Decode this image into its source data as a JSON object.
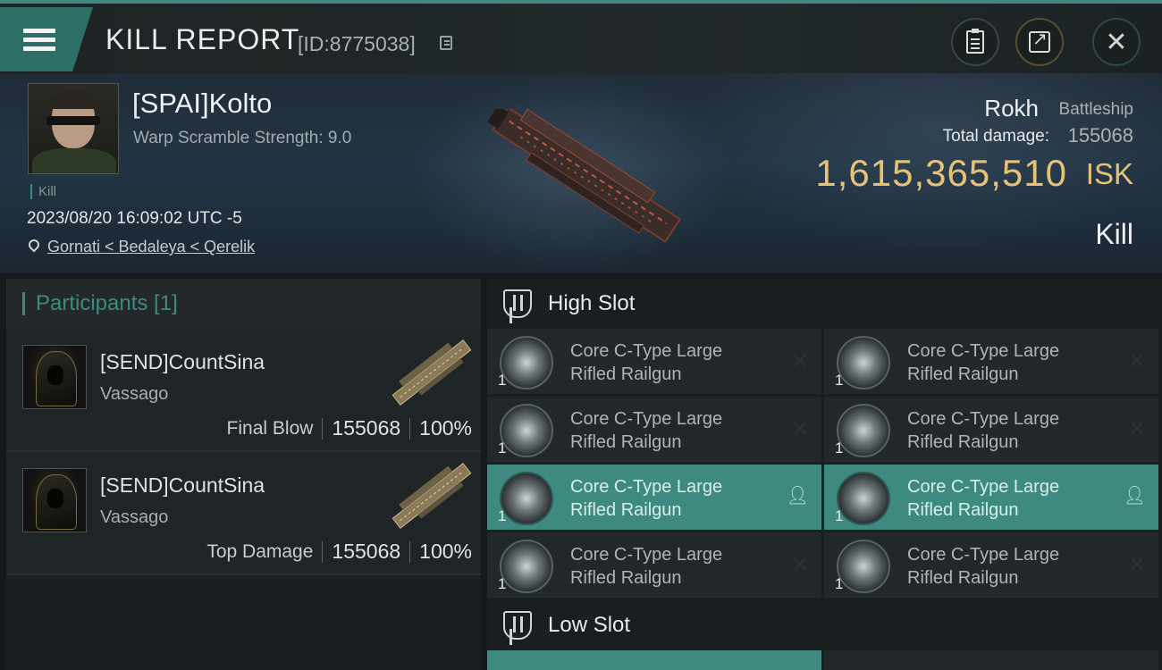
{
  "header": {
    "title": "KILL REPORT",
    "kill_id": "[ID:8775038]"
  },
  "victim": {
    "name": "[SPAI]Kolto",
    "warp_scramble": "Warp Scramble Strength: 9.0",
    "tag": "Kill",
    "timestamp": "2023/08/20 16:09:02 UTC -5",
    "location": "Gornati < Bedaleya < Qerelik",
    "ship_name": "Rokh",
    "ship_class": "Battleship",
    "total_damage_label": "Total damage:",
    "total_damage": "155068",
    "isk_value": "1,615,365,510",
    "isk_unit": "ISK",
    "result": "Kill"
  },
  "participants": {
    "header": "Participants [1]",
    "list": [
      {
        "name": "[SEND]CountSina",
        "ship": "Vassago",
        "role": "Final Blow",
        "damage": "155068",
        "percent": "100%"
      },
      {
        "name": "[SEND]CountSina",
        "ship": "Vassago",
        "role": "Top Damage",
        "damage": "155068",
        "percent": "100%"
      }
    ]
  },
  "slots": {
    "high_label": "High Slot",
    "low_label": "Low Slot",
    "high_modules": [
      {
        "line1": "Core C-Type Large",
        "line2": "Rifled Railgun",
        "qty": "1",
        "state": "destroyed"
      },
      {
        "line1": "Core C-Type Large",
        "line2": "Rifled Railgun",
        "qty": "1",
        "state": "destroyed"
      },
      {
        "line1": "Core C-Type Large",
        "line2": "Rifled Railgun",
        "qty": "1",
        "state": "destroyed"
      },
      {
        "line1": "Core C-Type Large",
        "line2": "Rifled Railgun",
        "qty": "1",
        "state": "destroyed"
      },
      {
        "line1": "Core C-Type Large",
        "line2": "Rifled Railgun",
        "qty": "1",
        "state": "dropped"
      },
      {
        "line1": "Core C-Type Large",
        "line2": "Rifled Railgun",
        "qty": "1",
        "state": "dropped"
      },
      {
        "line1": "Core C-Type Large",
        "line2": "Rifled Railgun",
        "qty": "1",
        "state": "destroyed"
      },
      {
        "line1": "Core C-Type Large",
        "line2": "Rifled Railgun",
        "qty": "1",
        "state": "destroyed"
      }
    ],
    "state_icons": {
      "destroyed": "✕",
      "dropped": "person-icon"
    }
  },
  "colors": {
    "accent": "#3f8a80",
    "isk": "#e6c279"
  }
}
